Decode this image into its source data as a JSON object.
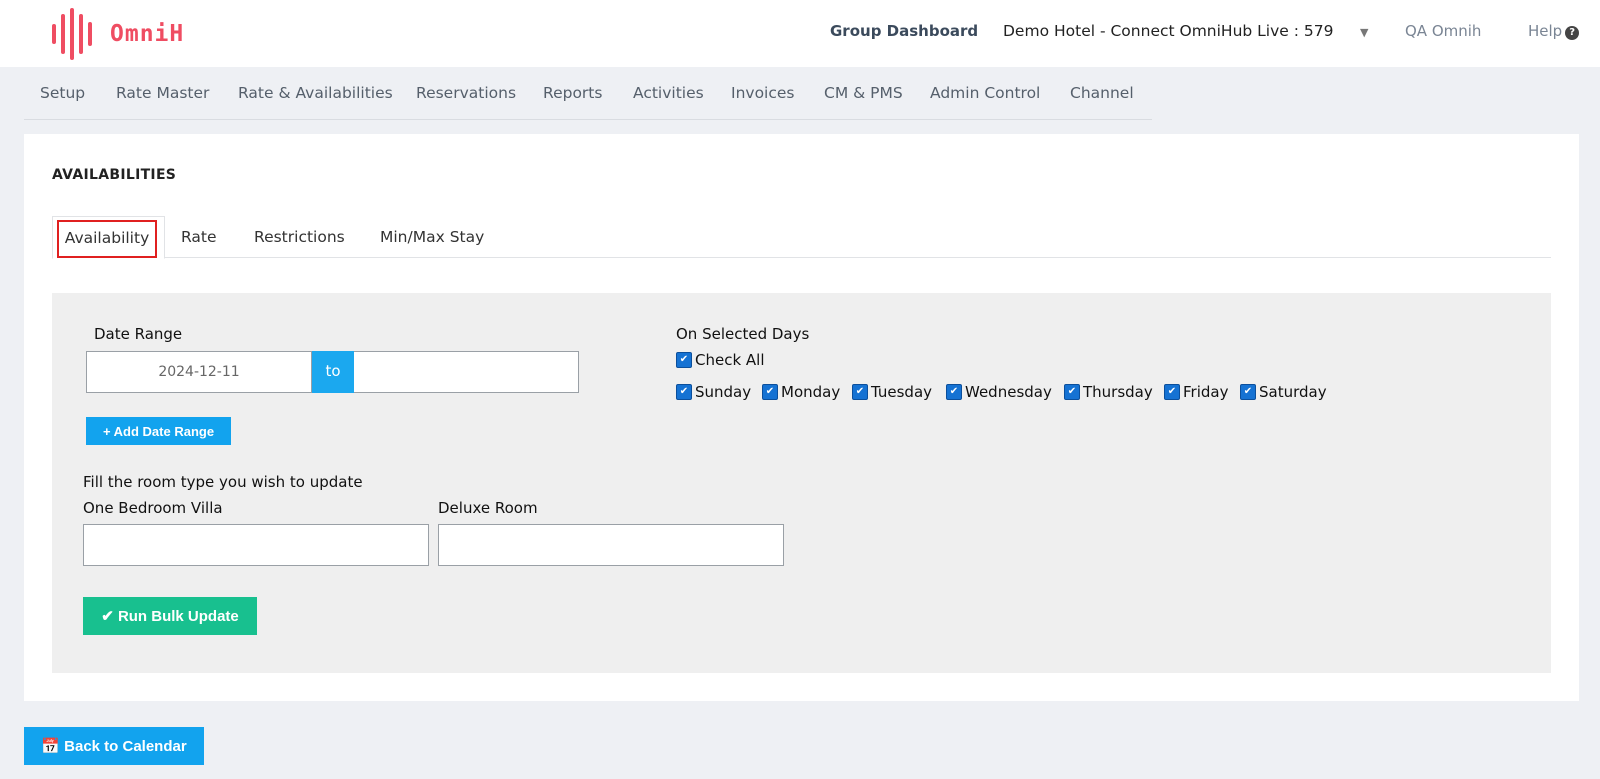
{
  "header": {
    "logo_text": "OmniH",
    "brand_color": "#ef4d62",
    "group_dashboard": "Group Dashboard",
    "hotel": "Demo Hotel - Connect OmniHub Live : 579",
    "caret": "▼",
    "user": "QA Omnih",
    "help": "Help",
    "help_icon_glyph": "?"
  },
  "nav": {
    "items": [
      "Setup",
      "Rate Master",
      "Rate & Availabilities",
      "Reservations",
      "Reports",
      "Activities",
      "Invoices",
      "CM & PMS",
      "Admin Control",
      "Channel"
    ]
  },
  "section": {
    "title": "AVAILABILITIES",
    "tabs": [
      "Availability",
      "Rate",
      "Restrictions",
      "Min/Max Stay"
    ],
    "active_tab": "Availability"
  },
  "form": {
    "date_range_label": "Date Range",
    "date_from_value": "2024-12-11",
    "to_label": "to",
    "date_to_value": "",
    "add_date_range_label": "+ Add Date Range",
    "on_selected_days_label": "On Selected Days",
    "check_all_label": "Check All",
    "days": [
      "Sunday",
      "Monday",
      "Tuesday",
      "Wednesday",
      "Thursday",
      "Friday",
      "Saturday"
    ],
    "room_prompt": "Fill the room type you wish to update",
    "rooms": [
      {
        "label": "One Bedroom Villa",
        "value": ""
      },
      {
        "label": "Deluxe Room",
        "value": ""
      }
    ],
    "run_button_label": "✔ Run Bulk Update"
  },
  "footer": {
    "back_button_label": "📅 Back to Calendar"
  },
  "colors": {
    "primary_blue": "#12a3ee",
    "success_green": "#18c08f",
    "checkbox_blue": "#1572d3",
    "highlight_red": "#e02020"
  }
}
